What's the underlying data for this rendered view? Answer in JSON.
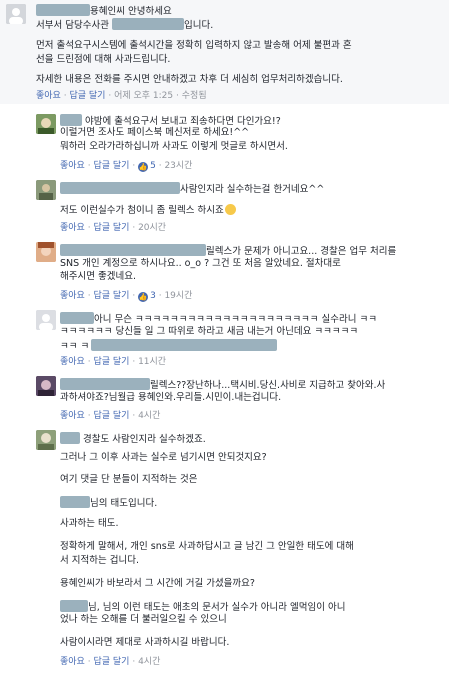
{
  "post": {
    "name_suffix": "용혜인씨 안녕하세요",
    "line2a": "서부서 담당수사관",
    "line2b": "입니다.",
    "line3": "먼저 출석요구시스템에 출석시간을 정확히 입력하지 않고 발송해 어제 불편과 혼",
    "line4": "선을 드린점에 대해 사과드립니다.",
    "line5": "자세한 내용은 전화를 주시면 안내하겠고 차후 더 세심히 업무처리하겠습니다.",
    "like": "좋아요",
    "reply": "답글 달기",
    "time": "어제 오후 1:25",
    "edited": "수정됨"
  },
  "comments": [
    {
      "lines": [
        "야밤에 출석요구서 보내고 죄송하다면 다인가요!?",
        "이럴거면 조사도 페이스북 메신저로 하세요!^^",
        "뭐하러 오라가라하십니까 사과도 이렇게 멋글로 하시면서."
      ],
      "like": "좋아요",
      "reply": "답글 달기",
      "likes": "5",
      "time": "23시간"
    },
    {
      "line1_suffix": "사람인지라 실수하는걸 한거네요^^",
      "line2": "저도 이런실수가 첨이니 좀 릴렉스 하시죠",
      "like": "좋아요",
      "reply": "답글 달기",
      "time": "20시간"
    },
    {
      "line1_suffix": "릴렉스가 문제가 아니고요... 경찰은 업무 처리를",
      "line2": "SNS 개인 계정으로 하시나요.. o_o ? 그건 또 처음 알았네요. 절차대로",
      "line3": "해주시면 좋겠네요.",
      "like": "좋아요",
      "reply": "답글 달기",
      "likes": "3",
      "time": "19시간"
    },
    {
      "line1a": "아니 무슨 ㅋㅋㅋㅋㅋㅋㅋㅋㅋㅋㅋㅋㅋㅋㅋㅋㅋㅋㅋㅋㅋ 실수라니 ㅋㅋ",
      "line2": "ㅋㅋㅋㅋㅋㅋ 당신들 일 그 따위로 하라고 새금 내는거 아닌데요 ㅋㅋㅋㅋㅋ",
      "line3": "ㅋㅋ ㅋ",
      "like": "좋아요",
      "reply": "답글 달기",
      "time": "11시간"
    },
    {
      "line1_suffix": "릴렉스??장난하나...택시비.당신.사비로 지급하고 찾아와.사",
      "line2": "과하셔야죠?님월급 용혜인와.우리들.시민이.내는겁니다.",
      "like": "좋아요",
      "reply": "답글 달기",
      "time": "4시간"
    },
    {
      "line1_suffix": "경찰도 사람인지라 실수하겠죠.",
      "p2": "그러나 그 이후 사과는 실수로 넘기시면 안되것지요?",
      "p3": "여기 댓글 단 분들이 지적하는 것은",
      "p4_suffix": "님의 태도입니다.",
      "p5": "사과하는 태도.",
      "p6a": "정확하게 말해서, 개인 sns로 사과하답시고 글 남긴 그 안일한 태도에 대해",
      "p6b": "서 지적하는 겁니다.",
      "p7": "용혜인씨가 바보라서 그 시간에 거길 가셨을까요?",
      "p8a_suffix": "님, 님의 이런 태도는 애초의 문서가 실수가 아니라 엘먹임이 아니",
      "p8b": "었나 하는 오해를 더 불러일으킬 수 있으니",
      "p9": "사람이시라면 제대로 사과하시길 바랍니다.",
      "like": "좋아요",
      "reply": "답글 달기",
      "time": "4시간"
    }
  ],
  "colors": {
    "link": "#365899",
    "meta": "#90949c",
    "accent": "#4267b2"
  }
}
